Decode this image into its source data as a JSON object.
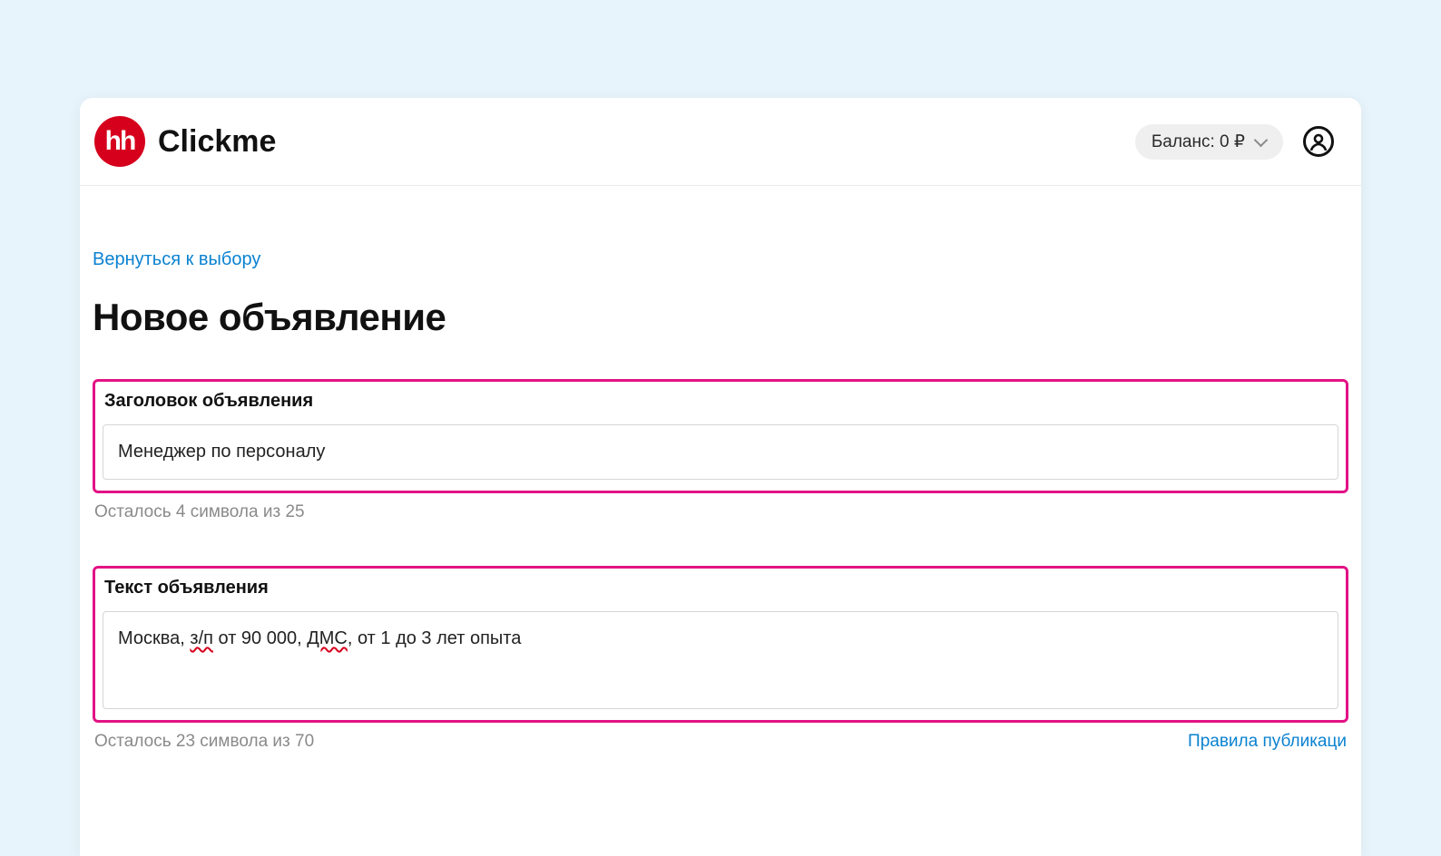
{
  "header": {
    "logo_text": "hh",
    "brand_label": "Clickme",
    "balance_label": "Баланс: 0 ₽"
  },
  "nav": {
    "back_link_label": "Вернуться к выбору"
  },
  "page": {
    "title": "Новое объявление"
  },
  "form": {
    "title_field": {
      "label": "Заголовок объявления",
      "value": "Менеджер по персоналу",
      "remaining_text": "Осталось 4 символа из 25",
      "remaining": 4,
      "max": 25
    },
    "body_field": {
      "label": "Текст объявления",
      "value": "Москва, з/п от 90 000, ДМС, от 1 до 3 лет опыта",
      "value_parts": [
        {
          "t": "Москва, ",
          "sq": false
        },
        {
          "t": "з/п",
          "sq": true
        },
        {
          "t": " от 90 000, ",
          "sq": false
        },
        {
          "t": "ДМС",
          "sq": true
        },
        {
          "t": ", от 1 до 3 лет опыта",
          "sq": false
        }
      ],
      "remaining_text": "Осталось 23 символа из 70",
      "remaining": 23,
      "max": 70,
      "rules_link_label": "Правила публикаци"
    }
  }
}
